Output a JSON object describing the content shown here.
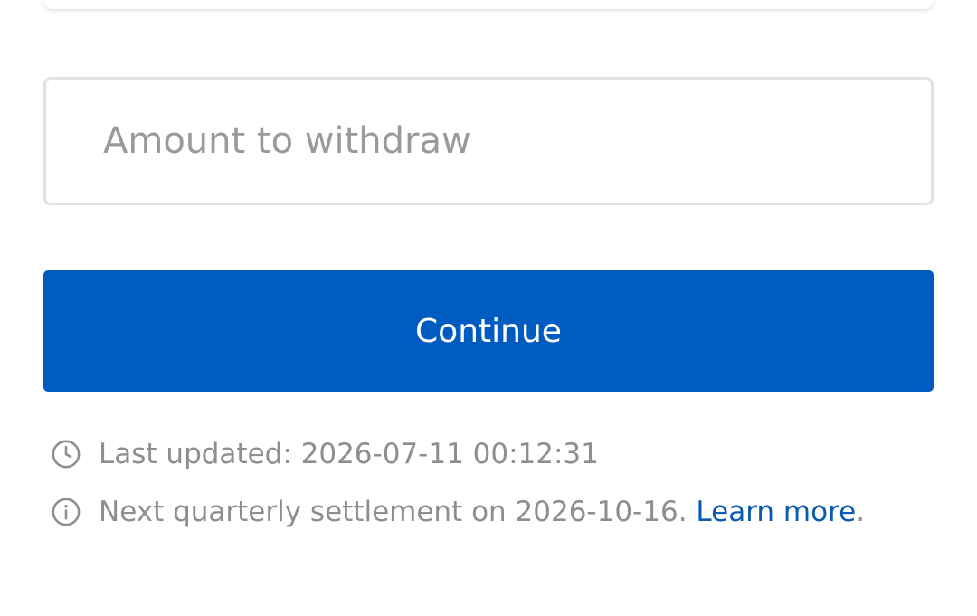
{
  "amount_field": {
    "placeholder": "Amount to withdraw",
    "value": ""
  },
  "continue_button": {
    "label": "Continue"
  },
  "last_updated": {
    "icon": "clock-icon",
    "text": "Last updated: 2026-07-11 00:12:31"
  },
  "settlement_notice": {
    "icon": "info-icon",
    "text": "Next quarterly settlement on 2026-10-16. ",
    "link_label": "Learn more",
    "trailing": "."
  },
  "colors": {
    "primary": "#005bc1",
    "link": "#0a5ab0",
    "muted_text": "#8e8e8e",
    "field_border": "#e2e2e2"
  }
}
